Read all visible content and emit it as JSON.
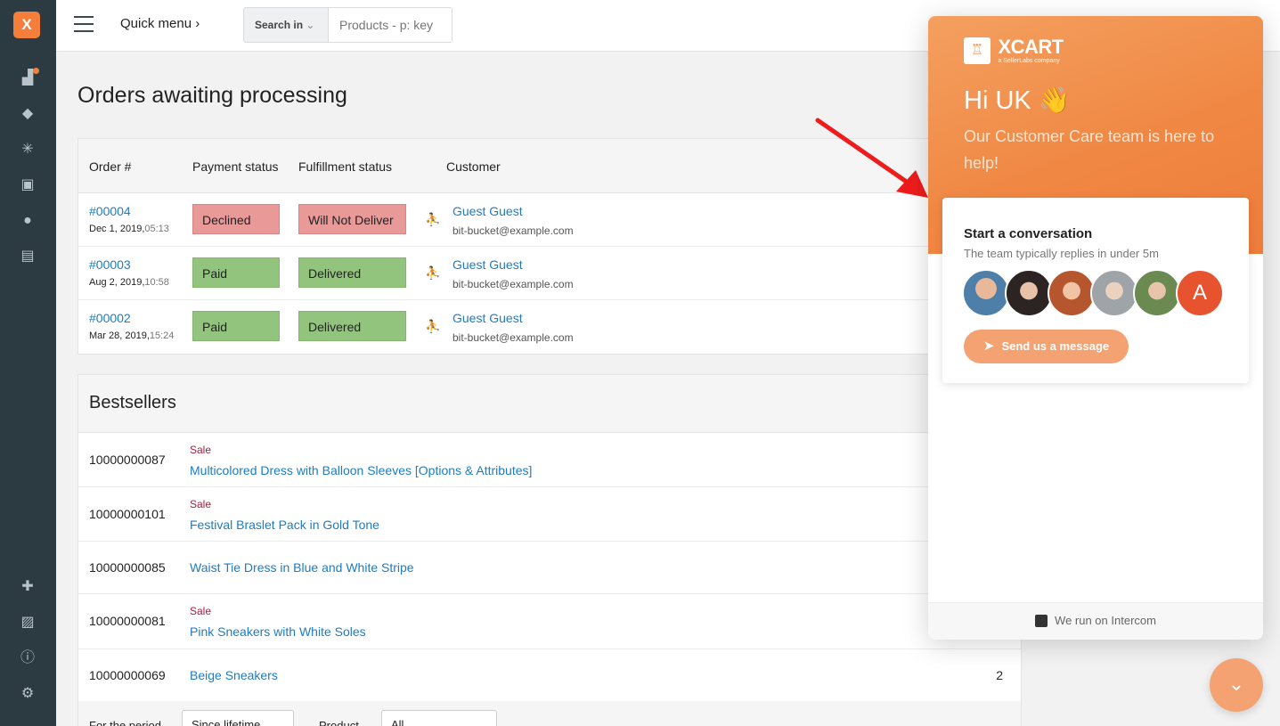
{
  "app": {
    "logo_glyph": "X",
    "accent": "#f47e3a"
  },
  "sidebar": {
    "icons": [
      "dashboard-icon",
      "tag-icon",
      "network-icon",
      "gift-icon",
      "users-icon",
      "news-icon",
      "puzzle-icon",
      "image-icon",
      "info-icon",
      "gear-icon"
    ]
  },
  "header": {
    "quick_menu": "Quick menu",
    "search_in": "Search in",
    "search_placeholder": "Products - p: key"
  },
  "orders": {
    "title": "Orders awaiting processing",
    "columns": [
      "Order #",
      "Payment status",
      "Fulfillment status",
      "Customer"
    ],
    "rows": [
      {
        "number": "#00004",
        "date": "Dec 1, 2019,",
        "time": "05:13",
        "payment": "Declined",
        "fulfillment": "Will Not Deliver",
        "customer": "Guest Guest",
        "email": "bit-bucket@example.com"
      },
      {
        "number": "#00003",
        "date": "Aug 2, 2019,",
        "time": "10:58",
        "payment": "Paid",
        "fulfillment": "Delivered",
        "customer": "Guest Guest",
        "email": "bit-bucket@example.com"
      },
      {
        "number": "#00002",
        "date": "Mar 28, 2019,",
        "time": "15:24",
        "payment": "Paid",
        "fulfillment": "Delivered",
        "customer": "Guest Guest",
        "email": "bit-bucket@example.com"
      }
    ]
  },
  "bestsellers": {
    "title": "Bestsellers",
    "rows": [
      {
        "sku": "10000000087",
        "sale": "Sale",
        "name": "Multicolored Dress with Balloon Sleeves [Options & Attributes]",
        "qty": ""
      },
      {
        "sku": "10000000101",
        "sale": "Sale",
        "name": "Festival Braslet Pack in Gold Tone",
        "qty": ""
      },
      {
        "sku": "10000000085",
        "sale": "",
        "name": "Waist Tie Dress in Blue and White Stripe",
        "qty": ""
      },
      {
        "sku": "10000000081",
        "sale": "Sale",
        "name": "Pink Sneakers with White Soles",
        "qty": ""
      },
      {
        "sku": "10000000069",
        "sale": "",
        "name": "Beige Sneakers",
        "qty": "2"
      }
    ],
    "footer": {
      "period_label": "For the period",
      "period_value": "Since lifetime",
      "product_label": "Product",
      "product_value": "All"
    }
  },
  "intercom": {
    "brand": "XCART",
    "brand_sub": "a SellerLabs company",
    "greeting": "Hi UK 👋",
    "subtitle": "Our Customer Care team is here to help!",
    "card_title": "Start a conversation",
    "card_sub": "The team typically replies in under 5m",
    "avatar_letter": "A",
    "send_label": "Send us a message",
    "footer": "We run on Intercom"
  }
}
